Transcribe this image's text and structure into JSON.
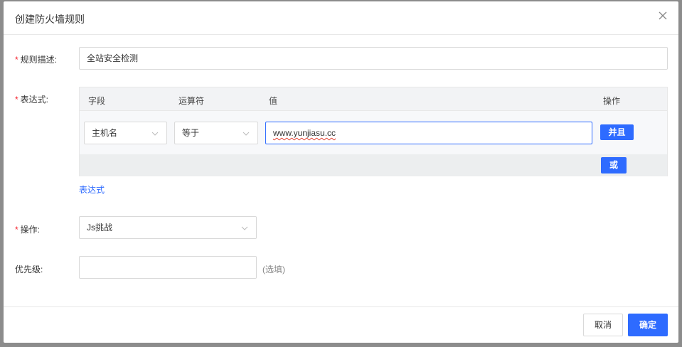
{
  "modal": {
    "title": "创建防火墙规则"
  },
  "form": {
    "description": {
      "label": "规则描述:",
      "value": "全站安全检测"
    },
    "expression": {
      "label": "表达式:",
      "columns": [
        "字段",
        "运算符",
        "值",
        "操作"
      ],
      "row": {
        "field": "主机名",
        "operator": "等于",
        "value": "www.yunjiasu.cc",
        "and_label": "并且"
      },
      "or_label": "或",
      "link_label": "表达式"
    },
    "action": {
      "label": "操作:",
      "value": "Js挑战"
    },
    "priority": {
      "label": "优先级:",
      "value": "",
      "hint": "(选填)"
    }
  },
  "footer": {
    "cancel_label": "取消",
    "confirm_label": "确定"
  },
  "colors": {
    "primary": "#2e6bff",
    "required": "#f5222d"
  }
}
